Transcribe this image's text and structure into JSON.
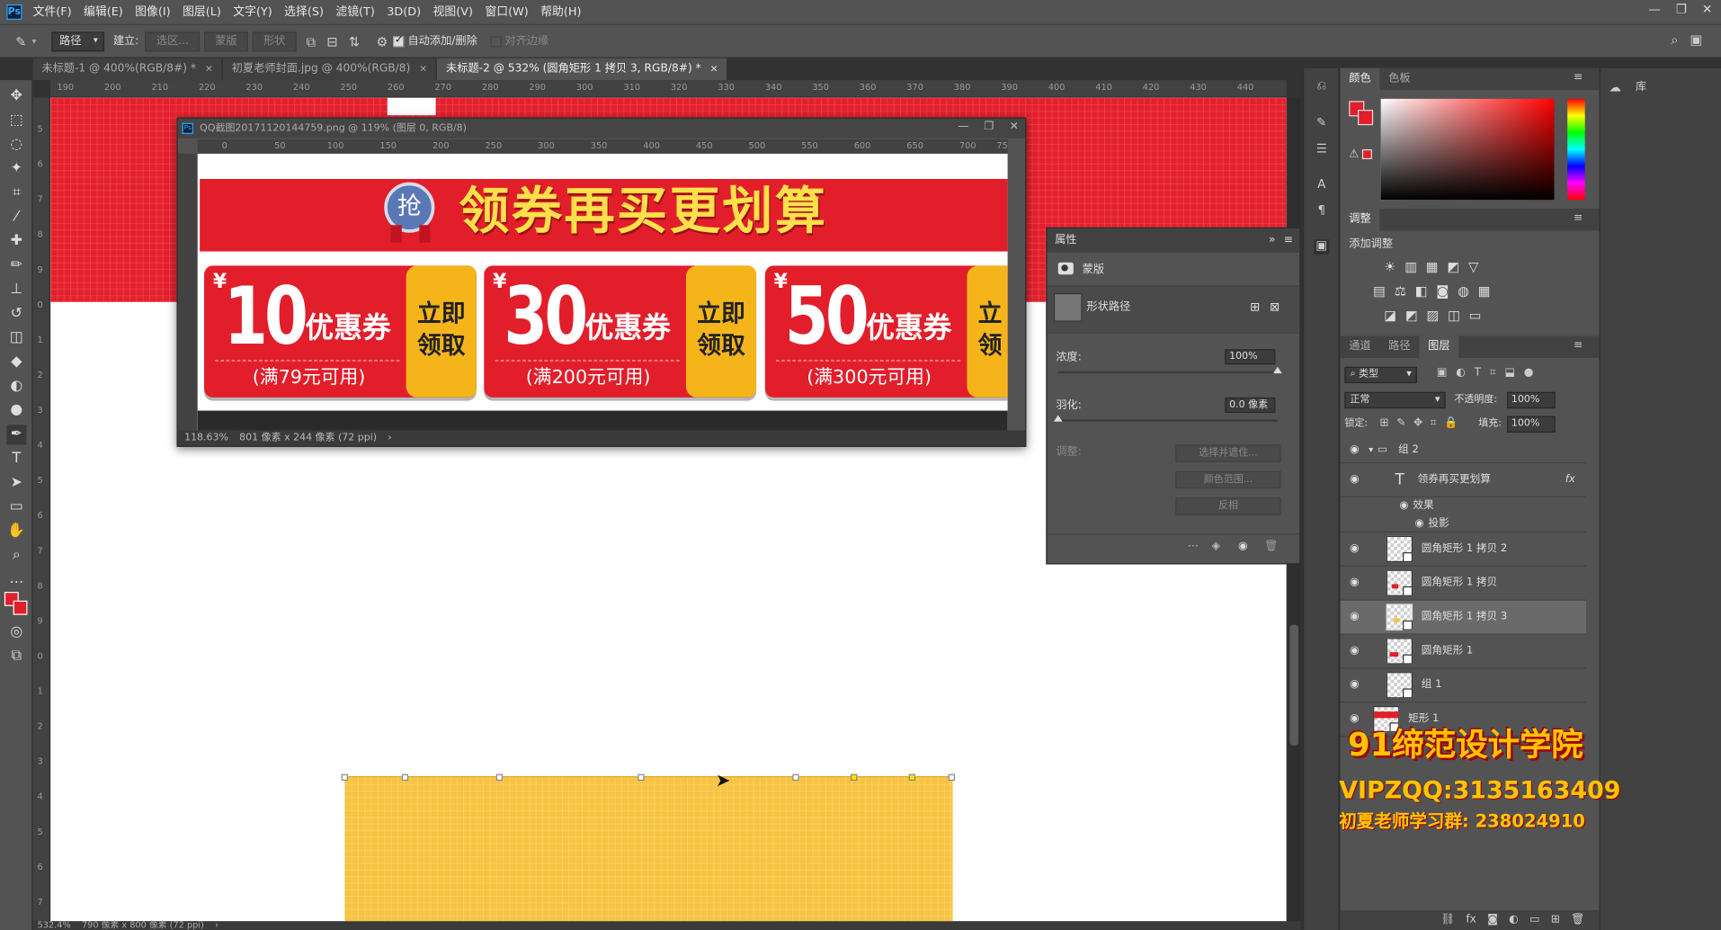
{
  "app": {
    "logo": "Ps"
  },
  "menu": [
    "文件(F)",
    "编辑(E)",
    "图像(I)",
    "图层(L)",
    "文字(Y)",
    "选择(S)",
    "滤镜(T)",
    "3D(D)",
    "视图(V)",
    "窗口(W)",
    "帮助(H)"
  ],
  "window_controls": {
    "minimize": "—",
    "restore": "❐",
    "close": "✕"
  },
  "options": {
    "tool_mode": "路径",
    "make_label": "建立:",
    "selection_btn": "选区...",
    "mask_btn": "蒙版",
    "shape_btn": "形状",
    "auto_add_delete": "自动添加/删除",
    "align_edges": "对齐边缘"
  },
  "tabs": [
    {
      "label": "未标题-1 @ 400%(RGB/8#) *",
      "close": "×"
    },
    {
      "label": "初夏老师封面.jpg @ 400%(RGB/8)",
      "close": "×"
    },
    {
      "label": "未标题-2 @ 532% (圆角矩形 1 拷贝 3, RGB/8#) *",
      "close": "×"
    }
  ],
  "ruler_top": [
    "190",
    "200",
    "210",
    "220",
    "230",
    "240",
    "250",
    "260",
    "270",
    "280",
    "290",
    "300",
    "310",
    "320",
    "330",
    "340",
    "350",
    "360",
    "370",
    "380",
    "390",
    "400",
    "410",
    "420",
    "430",
    "440"
  ],
  "ruler_left": [
    "5",
    "6",
    "7",
    "8",
    "9",
    "0",
    "1",
    "2",
    "3",
    "4",
    "5",
    "6",
    "7",
    "8",
    "9",
    "0",
    "1",
    "2",
    "3",
    "4",
    "5",
    "6",
    "7"
  ],
  "status_main": {
    "zoom": "532.4%",
    "size": "790 像素 x 800 像素 (72 ppi)",
    "arrow": "›"
  },
  "qq_window": {
    "title": "QQ截图20171120144759.png @ 119% (图层 0, RGB/8)",
    "ruler": [
      "0",
      "50",
      "100",
      "150",
      "200",
      "250",
      "300",
      "350",
      "400",
      "450",
      "500",
      "550",
      "600",
      "650",
      "700",
      "75"
    ],
    "zoom": "118.63%",
    "size": "801 像素 x 244 像素 (72 ppi)",
    "arrow": "›",
    "banner_text": "领券再买更划算",
    "badge_text": "抢",
    "coupons": [
      {
        "yen": "¥",
        "amount": "10",
        "label": "优惠券",
        "condition": "(满79元可用)",
        "claim1": "立即",
        "claim2": "领取"
      },
      {
        "yen": "¥",
        "amount": "30",
        "label": "优惠券",
        "condition": "(满200元可用)",
        "claim1": "立即",
        "claim2": "领取"
      },
      {
        "yen": "¥",
        "amount": "50",
        "label": "优惠券",
        "condition": "(满300元可用)",
        "claim1": "立",
        "claim2": "领"
      }
    ]
  },
  "properties": {
    "title": "属性",
    "expand": "»",
    "menu": "≡",
    "mask_label": "蒙版",
    "shape_path": "形状路径",
    "density_label": "浓度:",
    "density_value": "100%",
    "density_fraction": 1.0,
    "feather_label": "羽化:",
    "feather_value": "0.0 像素",
    "feather_fraction": 0.0,
    "adjust_label": "调整:",
    "select_mask": "选择并遮住...",
    "color_range": "颜色范围...",
    "invert": "反相"
  },
  "color_panel": {
    "tab1": "颜色",
    "tab2": "色板",
    "menu": "≡",
    "foreground": "#e21e2b",
    "background": "#e21e2b"
  },
  "adjustments": {
    "title": "调整",
    "menu": "≡",
    "add_label": "添加调整"
  },
  "layers_panel": {
    "tabs": [
      "通道",
      "路径",
      "图层"
    ],
    "menu": "≡",
    "filter_label": "类型",
    "blend_mode": "正常",
    "opacity_label": "不透明度:",
    "opacity_value": "100%",
    "lock_label": "锁定:",
    "fill_label": "填充:",
    "fill_value": "100%",
    "layers": [
      {
        "name": "组 2",
        "kind": "group"
      },
      {
        "name": "领券再买更划算",
        "kind": "text",
        "fx": "fx"
      },
      {
        "name": "效果",
        "kind": "effect"
      },
      {
        "name": "投影",
        "kind": "effect2"
      },
      {
        "name": "圆角矩形 1 拷贝 2",
        "kind": "shape"
      },
      {
        "name": "圆角矩形 1 拷贝",
        "kind": "shape"
      },
      {
        "name": "圆角矩形 1 拷贝 3",
        "kind": "shape",
        "selected": true
      },
      {
        "name": "圆角矩形 1",
        "kind": "shape"
      },
      {
        "name": "组 1",
        "kind": "shape"
      },
      {
        "name": "矩形 1",
        "kind": "shape"
      }
    ]
  },
  "library": {
    "label": "库"
  },
  "watermark": {
    "line1": "91缔范设计学院",
    "line2": "VIPZQQ:3135163409",
    "line3": "初夏老师学习群: 238024910"
  },
  "colors": {
    "canvas_red": "#e5202d",
    "canvas_yellow": "#f7c341",
    "ps_blue": "#31a8ff"
  }
}
